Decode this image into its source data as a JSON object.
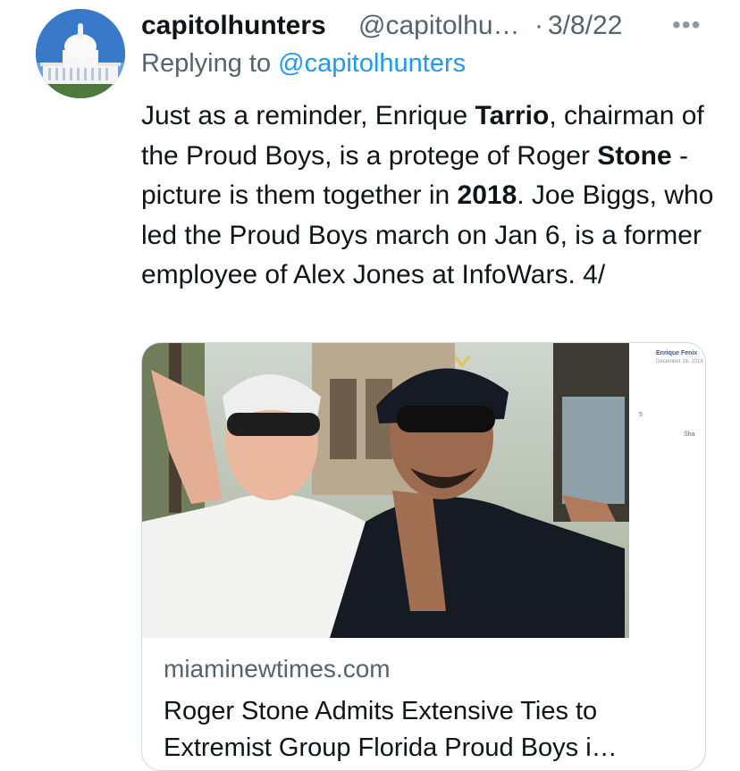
{
  "tweet": {
    "author_name": "capitolhunters",
    "author_handle": "@capitolhu…",
    "separator": "·",
    "date": "3/8/22",
    "more_icon": "more-horizontal-icon",
    "reply_prefix": "Replying to ",
    "reply_to": "@capitolhunters",
    "text": {
      "p1": "Just as a reminder, Enrique ",
      "b1": "Tarrio",
      "p2": ", chairman of the Proud Boys, is a protege of Roger ",
      "b2": "Stone",
      "p3": " - picture is them together in ",
      "b3": "2018",
      "p4": ". Joe Biggs, who led the Proud Boys march on Jan 6, is a former employee of Alex Jones at InfoWars.  4/"
    }
  },
  "card": {
    "domain": "miaminewtimes.com",
    "title_line1": "Roger Stone Admits Extensive Ties to",
    "title_line2": "Extremist Group Florida Proud Boys i…",
    "fb_name": "Enrique Fenix",
    "fb_date": "December 19, 2018",
    "fb_count": "5",
    "fb_share": "Sha"
  },
  "colors": {
    "accent": "#1d9bf0",
    "secondary_text": "#536471",
    "primary_text": "#0f1419",
    "border": "#cfd9de"
  }
}
